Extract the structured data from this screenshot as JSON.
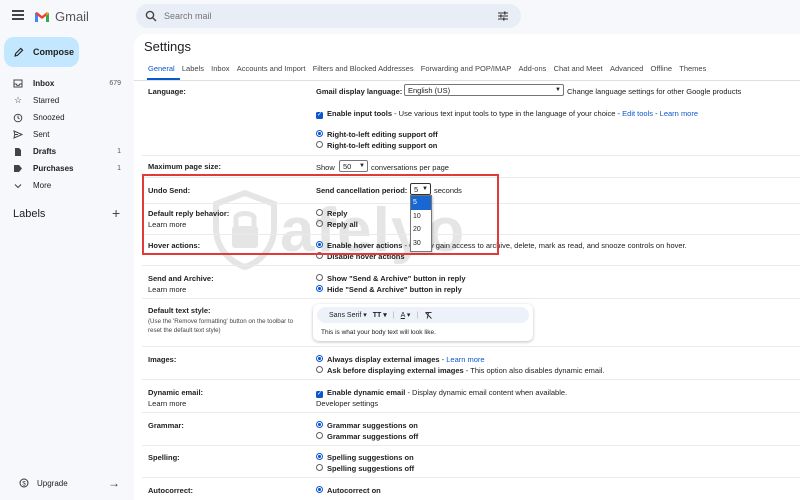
{
  "app": {
    "logo_text": "Gmail"
  },
  "search": {
    "placeholder": "Search mail"
  },
  "sidebar": {
    "compose_label": "Compose",
    "items": [
      {
        "label": "Inbox",
        "count": "679",
        "bold": true
      },
      {
        "label": "Starred",
        "count": ""
      },
      {
        "label": "Snoozed",
        "count": ""
      },
      {
        "label": "Sent",
        "count": ""
      },
      {
        "label": "Drafts",
        "count": "1",
        "bold": true
      },
      {
        "label": "Purchases",
        "count": "1",
        "bold": true
      },
      {
        "label": "More",
        "count": ""
      }
    ],
    "labels_title": "Labels",
    "upgrade_label": "Upgrade"
  },
  "settings": {
    "title": "Settings",
    "tabs": [
      "General",
      "Labels",
      "Inbox",
      "Accounts and Import",
      "Filters and Blocked Addresses",
      "Forwarding and POP/IMAP",
      "Add-ons",
      "Chat and Meet",
      "Advanced",
      "Offline",
      "Themes"
    ],
    "language": {
      "label": "Language:",
      "display_label": "Gmail display language:",
      "display_value": "English (US)",
      "change_link": "Change language settings for other Google products",
      "input_tools_label": "Enable input tools",
      "input_tools_desc": " - Use various text input tools to type in the language of your choice - ",
      "edit_tools_link": "Edit tools",
      "learn_more": "Learn more",
      "rtl_off": "Right-to-left editing support off",
      "rtl_on": "Right-to-left editing support on"
    },
    "page_size": {
      "label": "Maximum page size:",
      "show": "Show",
      "value": "50",
      "suffix": "conversations per page"
    },
    "undo_send": {
      "label": "Undo Send:",
      "period_label": "Send cancellation period:",
      "value": "5",
      "suffix": "seconds",
      "options": [
        "5",
        "10",
        "20",
        "30"
      ]
    },
    "reply": {
      "label": "Default reply behavior:",
      "learn_more": "Learn more",
      "reply": "Reply",
      "reply_all": "Reply all"
    },
    "hover": {
      "label": "Hover actions:",
      "enable": "Enable hover actions",
      "enable_desc": " - Quickly gain access to archive, delete, mark as read, and snooze controls on hover.",
      "disable": "Disable hover actions"
    },
    "send_archive": {
      "label": "Send and Archive:",
      "learn_more": "Learn more",
      "show": "Show \"Send & Archive\" button in reply",
      "hide": "Hide \"Send & Archive\" button in reply"
    },
    "text_style": {
      "label": "Default text style:",
      "sub": "(Use the 'Remove formatting' button on the toolbar to reset the default text style)",
      "font": "Sans Serif",
      "size_icon": "TT",
      "color_icon": "A",
      "preview": "This is what your body text will look like."
    },
    "images": {
      "label": "Images:",
      "always": "Always display external images",
      "learn_more": "Learn more",
      "ask": "Ask before displaying external images",
      "ask_desc": " - This option also disables dynamic email."
    },
    "dynamic_email": {
      "label": "Dynamic email:",
      "learn_more": "Learn more",
      "enable": "Enable dynamic email",
      "enable_desc": " - Display dynamic email content when available.",
      "dev_settings": "Developer settings"
    },
    "grammar": {
      "label": "Grammar:",
      "on": "Grammar suggestions on",
      "off": "Grammar suggestions off"
    },
    "spelling": {
      "label": "Spelling:",
      "on": "Spelling suggestions on",
      "off": "Spelling suggestions off"
    },
    "autocorrect": {
      "label": "Autocorrect:",
      "on": "Autocorrect on"
    }
  },
  "watermark": {
    "text": "afelyo"
  },
  "colors": {
    "accent": "#0b57d0",
    "highlight": "#e03a3a",
    "compose_bg": "#c2e7ff",
    "page_bg": "#f6f8fc"
  }
}
